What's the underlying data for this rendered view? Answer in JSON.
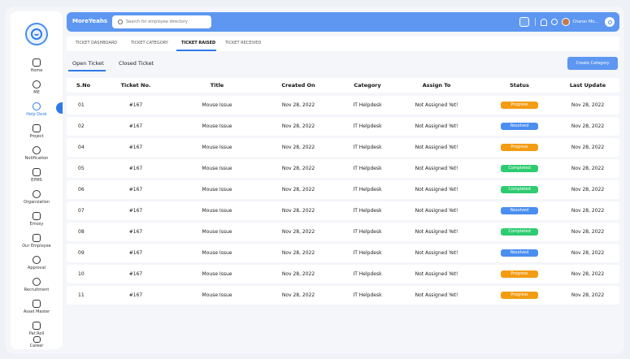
{
  "header": {
    "brand": "MoreYeahs",
    "search_placeholder": "Search for employee directory",
    "user_name": "Charon Mo..."
  },
  "sidebar": {
    "items": [
      {
        "label": "Home",
        "icon": "home-icon"
      },
      {
        "label": "ME",
        "icon": "user-icon"
      },
      {
        "label": "Help Desk",
        "icon": "help-desk-icon",
        "active": true
      },
      {
        "label": "Project",
        "icon": "clipboard-icon"
      },
      {
        "label": "Notification",
        "icon": "bell-icon"
      },
      {
        "label": "EPMS",
        "icon": "document-icon"
      },
      {
        "label": "Organization",
        "icon": "organization-icon"
      },
      {
        "label": "Emosy",
        "icon": "calendar-icon"
      },
      {
        "label": "Our Employee",
        "icon": "id-card-icon"
      },
      {
        "label": "Approval",
        "icon": "check-circle-icon"
      },
      {
        "label": "Recruitment",
        "icon": "recruitment-icon"
      },
      {
        "label": "Asset Master",
        "icon": "asset-icon"
      },
      {
        "label": "Pat Roll",
        "icon": "wallet-icon"
      },
      {
        "label": "Career",
        "icon": "briefcase-icon"
      }
    ]
  },
  "tabs": [
    {
      "label": "TICKET DASHBOARD"
    },
    {
      "label": "TICKET CATEGORY"
    },
    {
      "label": "TICKET RAISED",
      "active": true
    },
    {
      "label": "TICKET RECEIVED"
    }
  ],
  "subtabs": [
    {
      "label": "Open Ticket",
      "active": true
    },
    {
      "label": "Closed Ticket"
    }
  ],
  "create_button": "Create Category",
  "table": {
    "columns": [
      "S.No",
      "Ticket No.",
      "Title",
      "Created On",
      "Category",
      "Assign To",
      "Status",
      "Last Update"
    ],
    "rows": [
      {
        "sno": "01",
        "ticket": "#167",
        "title": "Mouse Issue",
        "created": "Nov 28, 2022",
        "category": "IT Helpdesk",
        "assign": "Not Assigned Yet!",
        "status": "Progress",
        "updated": "Nov 28, 2022"
      },
      {
        "sno": "02",
        "ticket": "#167",
        "title": "Mouse Issue",
        "created": "Nov 28, 2022",
        "category": "IT Helpdesk",
        "assign": "Not Assigned Yet!",
        "status": "Resolved",
        "updated": "Nov 28, 2022"
      },
      {
        "sno": "04",
        "ticket": "#167",
        "title": "Mouse Issue",
        "created": "Nov 28, 2022",
        "category": "IT Helpdesk",
        "assign": "Not Assigned Yet!",
        "status": "Progress",
        "updated": "Nov 28, 2022"
      },
      {
        "sno": "05",
        "ticket": "#167",
        "title": "Mouse Issue",
        "created": "Nov 28, 2022",
        "category": "IT Helpdesk",
        "assign": "Not Assigned Yet!",
        "status": "Completed",
        "updated": "Nov 28, 2022"
      },
      {
        "sno": "06",
        "ticket": "#167",
        "title": "Mouse Issue",
        "created": "Nov 28, 2022",
        "category": "IT Helpdesk",
        "assign": "Not Assigned Yet!",
        "status": "Completed",
        "updated": "Nov 28, 2022"
      },
      {
        "sno": "07",
        "ticket": "#167",
        "title": "Mouse Issue",
        "created": "Nov 28, 2022",
        "category": "IT Helpdesk",
        "assign": "Not Assigned Yet!",
        "status": "Resolved",
        "updated": "Nov 28, 2022"
      },
      {
        "sno": "08",
        "ticket": "#167",
        "title": "Mouse Issue",
        "created": "Nov 28, 2022",
        "category": "IT Helpdesk",
        "assign": "Not Assigned Yet!",
        "status": "Completed",
        "updated": "Nov 28, 2022"
      },
      {
        "sno": "09",
        "ticket": "#167",
        "title": "Mouse Issue",
        "created": "Nov 28, 2022",
        "category": "IT Helpdesk",
        "assign": "Not Assigned Yet!",
        "status": "Resolved",
        "updated": "Nov 28, 2022"
      },
      {
        "sno": "10",
        "ticket": "#167",
        "title": "Mouse Issue",
        "created": "Nov 28, 2022",
        "category": "IT Helpdesk",
        "assign": "Not Assigned Yet!",
        "status": "Progress",
        "updated": "Nov 28, 2022"
      },
      {
        "sno": "11",
        "ticket": "#167",
        "title": "Mouse Issue",
        "created": "Nov 28, 2022",
        "category": "IT Helpdesk",
        "assign": "Not Assigned Yet!",
        "status": "Progress",
        "updated": "Nov 28, 2022"
      }
    ]
  },
  "colors": {
    "accent": "#5d97f1",
    "status_progress": "#f39c12",
    "status_resolved": "#4a8ef0",
    "status_completed": "#2ecc71"
  }
}
